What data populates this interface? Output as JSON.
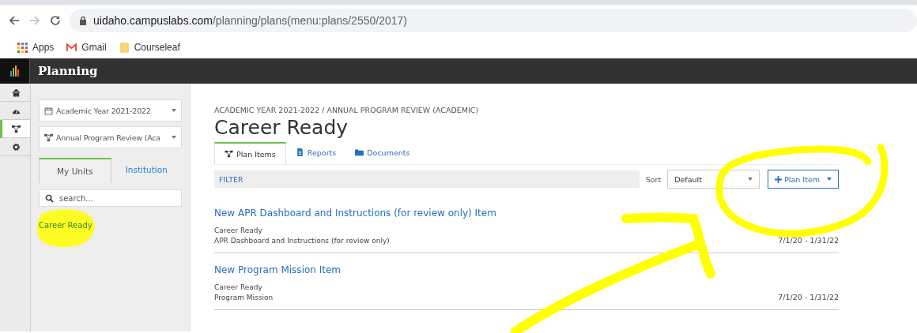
{
  "browser": {
    "url_host": "uidaho.campuslabs.com",
    "url_path": "/planning/plans(menu:plans/2550/2017)",
    "bookmarks": [
      {
        "label": "Apps",
        "kind": "apps"
      },
      {
        "label": "Gmail",
        "kind": "gmail"
      },
      {
        "label": "Courseleaf",
        "kind": "folder"
      }
    ]
  },
  "app": {
    "title": "Planning"
  },
  "rail": [
    {
      "kind": "home",
      "selected": false
    },
    {
      "kind": "dashboard",
      "selected": false
    },
    {
      "kind": "plans",
      "selected": true
    },
    {
      "kind": "settings",
      "selected": false
    }
  ],
  "sidebar": {
    "year_select": "Academic Year 2021-2022",
    "plan_select": "Annual Program Review (Aca",
    "unit_tabs": [
      {
        "label": "My Units",
        "selected": true
      },
      {
        "label": "Institution",
        "selected": false
      }
    ],
    "search": {
      "placeholder": "search..."
    },
    "units": [
      {
        "label": "Career Ready"
      }
    ]
  },
  "main": {
    "breadcrumb": "ACADEMIC YEAR 2021-2022 / ANNUAL PROGRAM REVIEW (ACADEMIC)",
    "title": "Career Ready",
    "tabs": [
      {
        "label": "Plan Items",
        "kind": "plans",
        "selected": true
      },
      {
        "label": "Reports",
        "kind": "file",
        "selected": false
      },
      {
        "label": "Documents",
        "kind": "folder",
        "selected": false
      }
    ],
    "filter": "FILTER",
    "sort_label": "Sort",
    "sort_value": "Default",
    "add_button": "Plan Item",
    "items": [
      {
        "title": "New APR Dashboard and Instructions (for review only) Item",
        "unit": "Career Ready",
        "subtitle": "APR Dashboard and Instructions (for review only)",
        "dates": "7/1/20 - 1/31/22"
      },
      {
        "title": "New Program Mission Item",
        "unit": "Career Ready",
        "subtitle": "Program Mission",
        "dates": "7/1/20 - 1/31/22"
      }
    ]
  }
}
